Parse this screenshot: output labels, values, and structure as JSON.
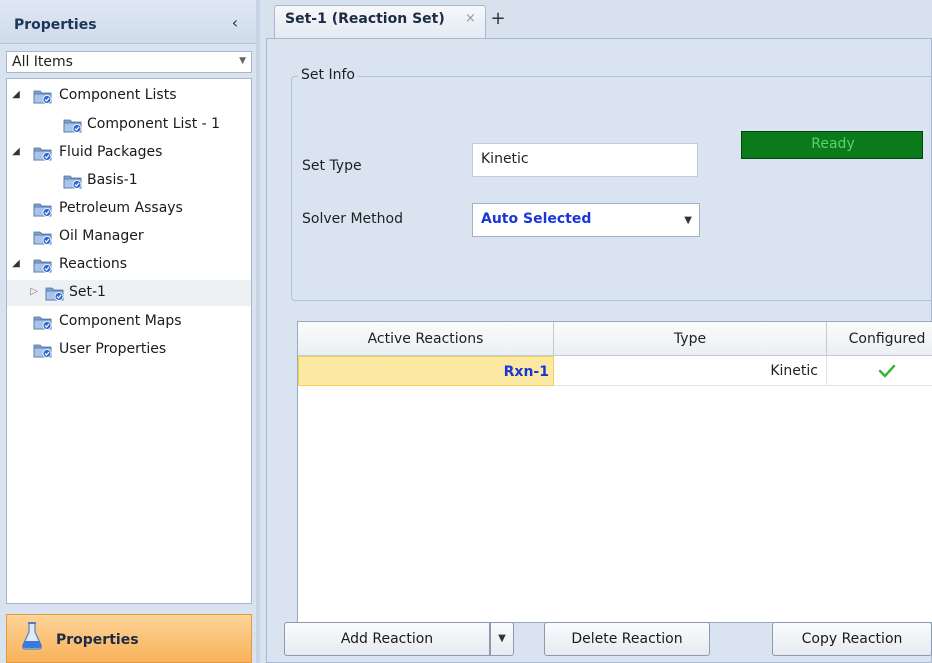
{
  "left_panel": {
    "title": "Properties",
    "collapse_glyph": "‹",
    "filter": {
      "value": "All Items"
    },
    "tree": [
      {
        "label": "Component Lists",
        "expander": "◢",
        "level": 0,
        "icon": "folder-check-icon"
      },
      {
        "label": "Component List - 1",
        "expander": "",
        "level": 1,
        "icon": "folder-check-icon"
      },
      {
        "label": "Fluid Packages",
        "expander": "◢",
        "level": 0,
        "icon": "folder-check-icon"
      },
      {
        "label": "Basis-1",
        "expander": "",
        "level": 1,
        "icon": "folder-check-icon"
      },
      {
        "label": "Petroleum Assays",
        "expander": "",
        "level": 0,
        "icon": "folder-check-icon"
      },
      {
        "label": "Oil Manager",
        "expander": "",
        "level": 0,
        "icon": "folder-check-icon"
      },
      {
        "label": "Reactions",
        "expander": "◢",
        "level": 0,
        "icon": "folder-check-icon"
      },
      {
        "label": "Set-1",
        "expander": "▷",
        "level": 1,
        "icon": "folder-check-icon",
        "selected": true
      },
      {
        "label": "Component Maps",
        "expander": "",
        "level": 0,
        "icon": "folder-check-icon"
      },
      {
        "label": "User Properties",
        "expander": "",
        "level": 0,
        "icon": "folder-check-icon"
      }
    ],
    "footer_tab": {
      "label": "Properties",
      "icon": "flask-icon"
    }
  },
  "tabs": {
    "active": {
      "title": "Set-1 (Reaction Set)",
      "close_glyph": "×"
    },
    "new_tab_glyph": "+"
  },
  "set_info": {
    "legend": "Set Info",
    "status": "Ready",
    "set_type_label": "Set Type",
    "set_type_value": "Kinetic",
    "solver_label": "Solver Method",
    "solver_value": "Auto Selected"
  },
  "reactions_grid": {
    "columns": [
      "Active Reactions",
      "Type",
      "Configured"
    ],
    "rows": [
      {
        "name": "Rxn-1",
        "type": "Kinetic",
        "configured": true
      }
    ]
  },
  "buttons": {
    "add": "Add Reaction",
    "delete": "Delete Reaction",
    "copy": "Copy Reaction"
  },
  "colors": {
    "status_bg": "#0a7a1a",
    "accent_blue": "#1a37d6",
    "selected_cell": "#fbe9a3",
    "footer_tab": "#f8b25a"
  }
}
